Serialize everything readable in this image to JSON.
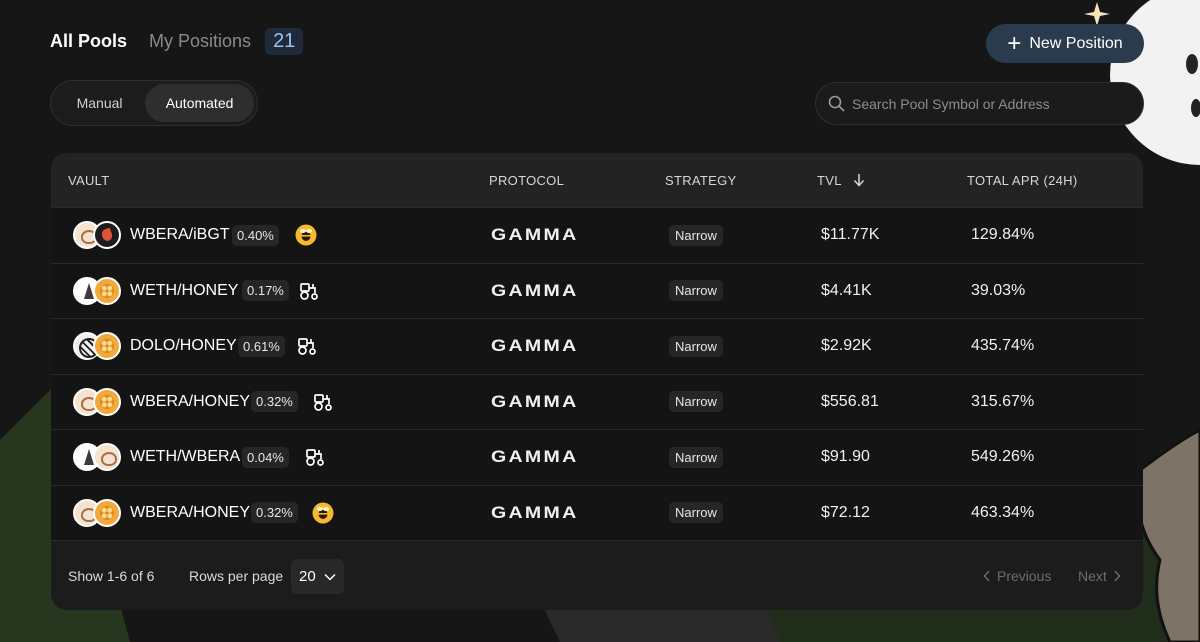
{
  "header": {
    "tabs": [
      {
        "label": "All Pools",
        "active": true
      },
      {
        "label": "My Positions",
        "active": false
      }
    ],
    "positions_count": "21",
    "new_position_label": "New Position"
  },
  "mode_toggle": {
    "options": [
      "Manual",
      "Automated"
    ],
    "selected": "Automated"
  },
  "search": {
    "placeholder": "Search Pool Symbol or Address",
    "value": ""
  },
  "table": {
    "columns": [
      "VAULT",
      "PROTOCOL",
      "STRATEGY",
      "TVL",
      "TOTAL APR (24H)"
    ],
    "sort": {
      "column": "TVL",
      "direction": "desc"
    },
    "rows": [
      {
        "pair": "WBERA/iBGT",
        "fee": "0.40%",
        "badge_icon": "bee-badge-icon",
        "tokens": [
          "bear",
          "ibgt"
        ],
        "protocol": "GAMMA",
        "strategy": "Narrow",
        "tvl": "$11.77K",
        "apr": "129.84%"
      },
      {
        "pair": "WETH/HONEY",
        "fee": "0.17%",
        "badge_icon": "tractor-icon",
        "tokens": [
          "eth",
          "honey"
        ],
        "protocol": "GAMMA",
        "strategy": "Narrow",
        "tvl": "$4.41K",
        "apr": "39.03%"
      },
      {
        "pair": "DOLO/HONEY",
        "fee": "0.61%",
        "badge_icon": "tractor-icon",
        "tokens": [
          "dolo",
          "honey"
        ],
        "protocol": "GAMMA",
        "strategy": "Narrow",
        "tvl": "$2.92K",
        "apr": "435.74%"
      },
      {
        "pair": "WBERA/HONEY",
        "fee": "0.32%",
        "badge_icon": "tractor-icon",
        "tokens": [
          "bear",
          "honey"
        ],
        "protocol": "GAMMA",
        "strategy": "Narrow",
        "tvl": "$556.81",
        "apr": "315.67%"
      },
      {
        "pair": "WETH/WBERA",
        "fee": "0.04%",
        "badge_icon": "tractor-icon",
        "tokens": [
          "eth",
          "bear"
        ],
        "protocol": "GAMMA",
        "strategy": "Narrow",
        "tvl": "$91.90",
        "apr": "549.26%"
      },
      {
        "pair": "WBERA/HONEY",
        "fee": "0.32%",
        "badge_icon": "bee-badge-icon",
        "tokens": [
          "bear",
          "honey"
        ],
        "protocol": "GAMMA",
        "strategy": "Narrow",
        "tvl": "$72.12",
        "apr": "463.34%"
      }
    ]
  },
  "footer": {
    "showing": "Show 1-6 of 6",
    "rows_per_page_label": "Rows per page",
    "rows_per_page_value": "20",
    "previous_label": "Previous",
    "next_label": "Next"
  },
  "colors": {
    "background": "#161616",
    "accent_button": "#2b3b4e",
    "count_badge_bg": "#1f2b3a",
    "count_badge_text": "#9ec3ea",
    "bee_badge": "#f5b82e"
  }
}
